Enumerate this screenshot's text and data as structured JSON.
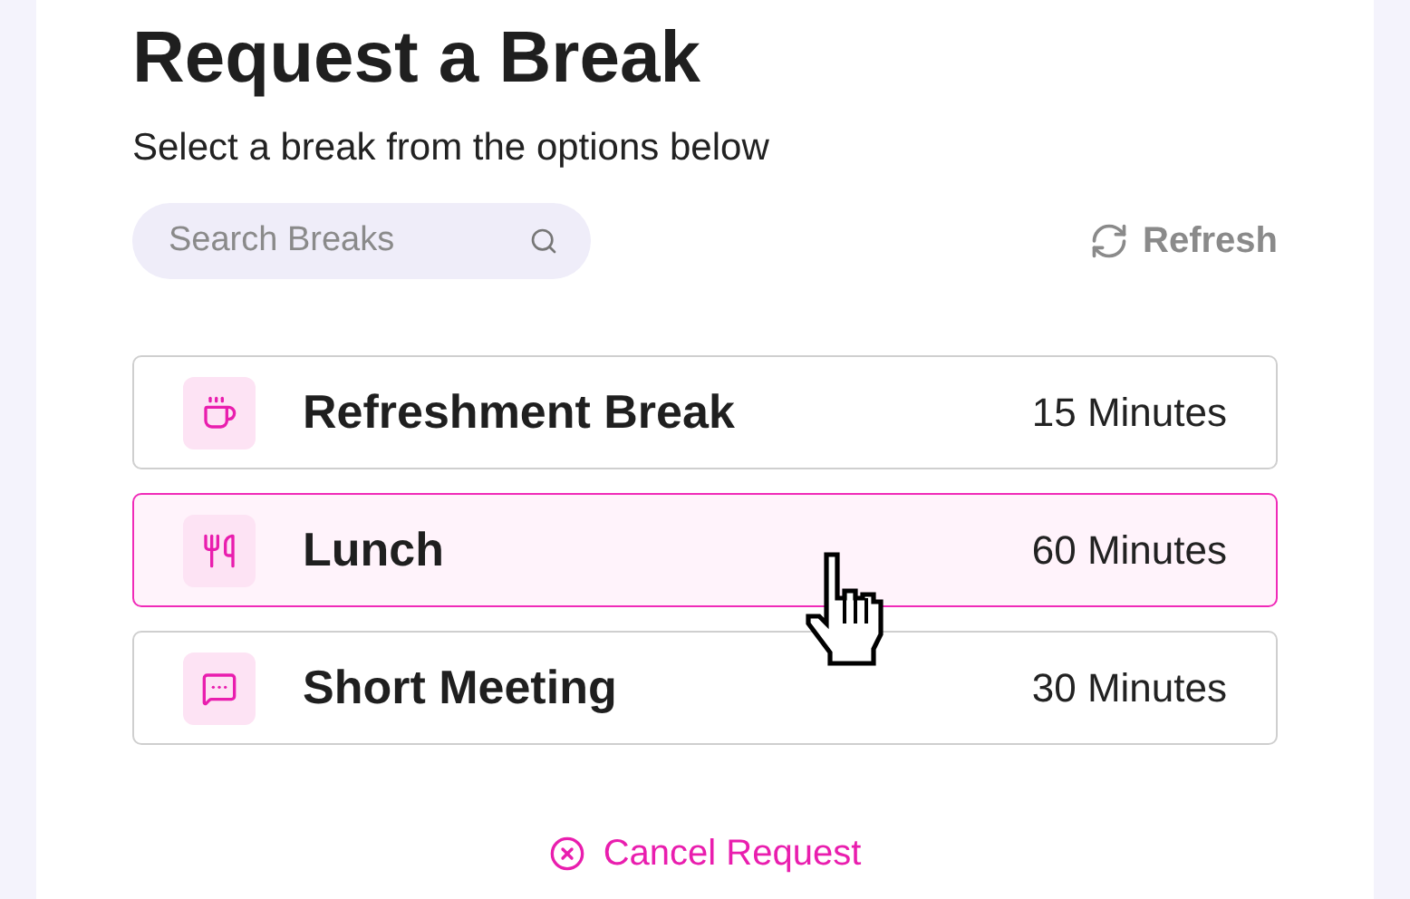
{
  "title": "Request a Break",
  "subtitle": "Select a break from the options below",
  "search": {
    "placeholder": "Search Breaks"
  },
  "refresh": {
    "label": "Refresh"
  },
  "breaks": [
    {
      "kind": "coffee",
      "name": "Refreshment Break",
      "duration": "15 Minutes",
      "selected": false
    },
    {
      "kind": "meal",
      "name": "Lunch",
      "duration": "60 Minutes",
      "selected": true
    },
    {
      "kind": "chat",
      "name": "Short Meeting",
      "duration": "30 Minutes",
      "selected": false
    }
  ],
  "cancel": {
    "label": "Cancel Request"
  }
}
